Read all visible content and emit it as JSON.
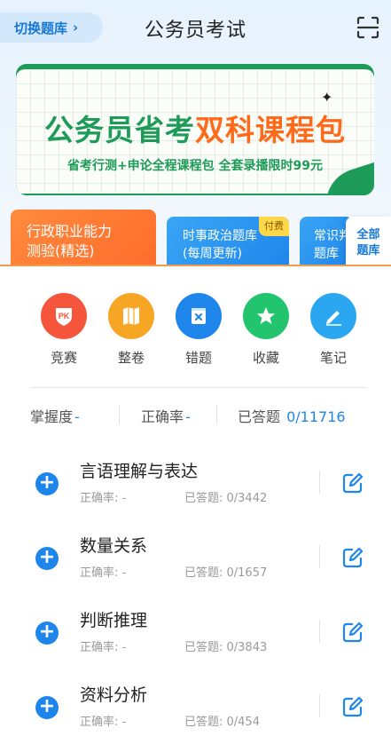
{
  "header": {
    "switch_label": "切换题库",
    "title": "公务员考试",
    "scan_icon": "scan-icon"
  },
  "banner": {
    "title_green": "公务员省考",
    "title_orange": "双科课程包",
    "subtitle": "省考行测+申论全程课程包 全套录播限时99元"
  },
  "categories": [
    {
      "line1": "行政职业能力",
      "line2": "测验(精选)"
    },
    {
      "line1": "时事政治题库",
      "line2": "(每周更新)",
      "badge": "付费"
    },
    {
      "line1": "常识判",
      "line2": "题库"
    }
  ],
  "all_library": {
    "line1": "全部",
    "line2": "题库"
  },
  "tools": [
    {
      "label": "竞赛",
      "icon": "pk-icon",
      "color": "#f5553a"
    },
    {
      "label": "整卷",
      "icon": "map-icon",
      "color": "#f7a623"
    },
    {
      "label": "错题",
      "icon": "wrong-icon",
      "color": "#1e86ea"
    },
    {
      "label": "收藏",
      "icon": "star-icon",
      "color": "#22c46e"
    },
    {
      "label": "笔记",
      "icon": "pen-icon",
      "color": "#2aa7f0"
    }
  ],
  "stats": {
    "mastery_label": "掌握度",
    "mastery_value": "-",
    "accuracy_label": "正确率",
    "accuracy_value": "-",
    "answered_label": "已答题",
    "answered_value": "0/11716"
  },
  "subjects": [
    {
      "name": "言语理解与表达",
      "accuracy": "正确率: -",
      "answered": "已答题: 0/3442"
    },
    {
      "name": "数量关系",
      "accuracy": "正确率: -",
      "answered": "已答题: 0/1657"
    },
    {
      "name": "判断推理",
      "accuracy": "正确率: -",
      "answered": "已答题: 0/3843"
    },
    {
      "name": "资料分析",
      "accuracy": "正确率: -",
      "answered": "已答题: 0/454"
    }
  ]
}
